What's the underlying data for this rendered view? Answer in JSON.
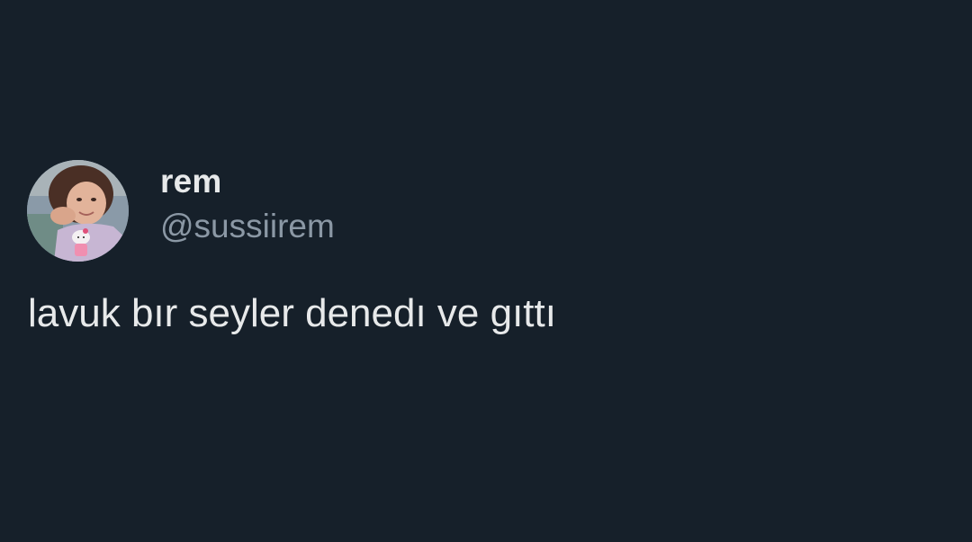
{
  "tweet": {
    "author": {
      "display_name": "rem",
      "handle": "@sussiirem",
      "avatar_icon": "profile-photo"
    },
    "text": "lavuk bır seyler denedı ve gıttı"
  },
  "colors": {
    "background": "#16202a",
    "primary_text": "#e7e9ea",
    "secondary_text": "#8b98a5"
  }
}
